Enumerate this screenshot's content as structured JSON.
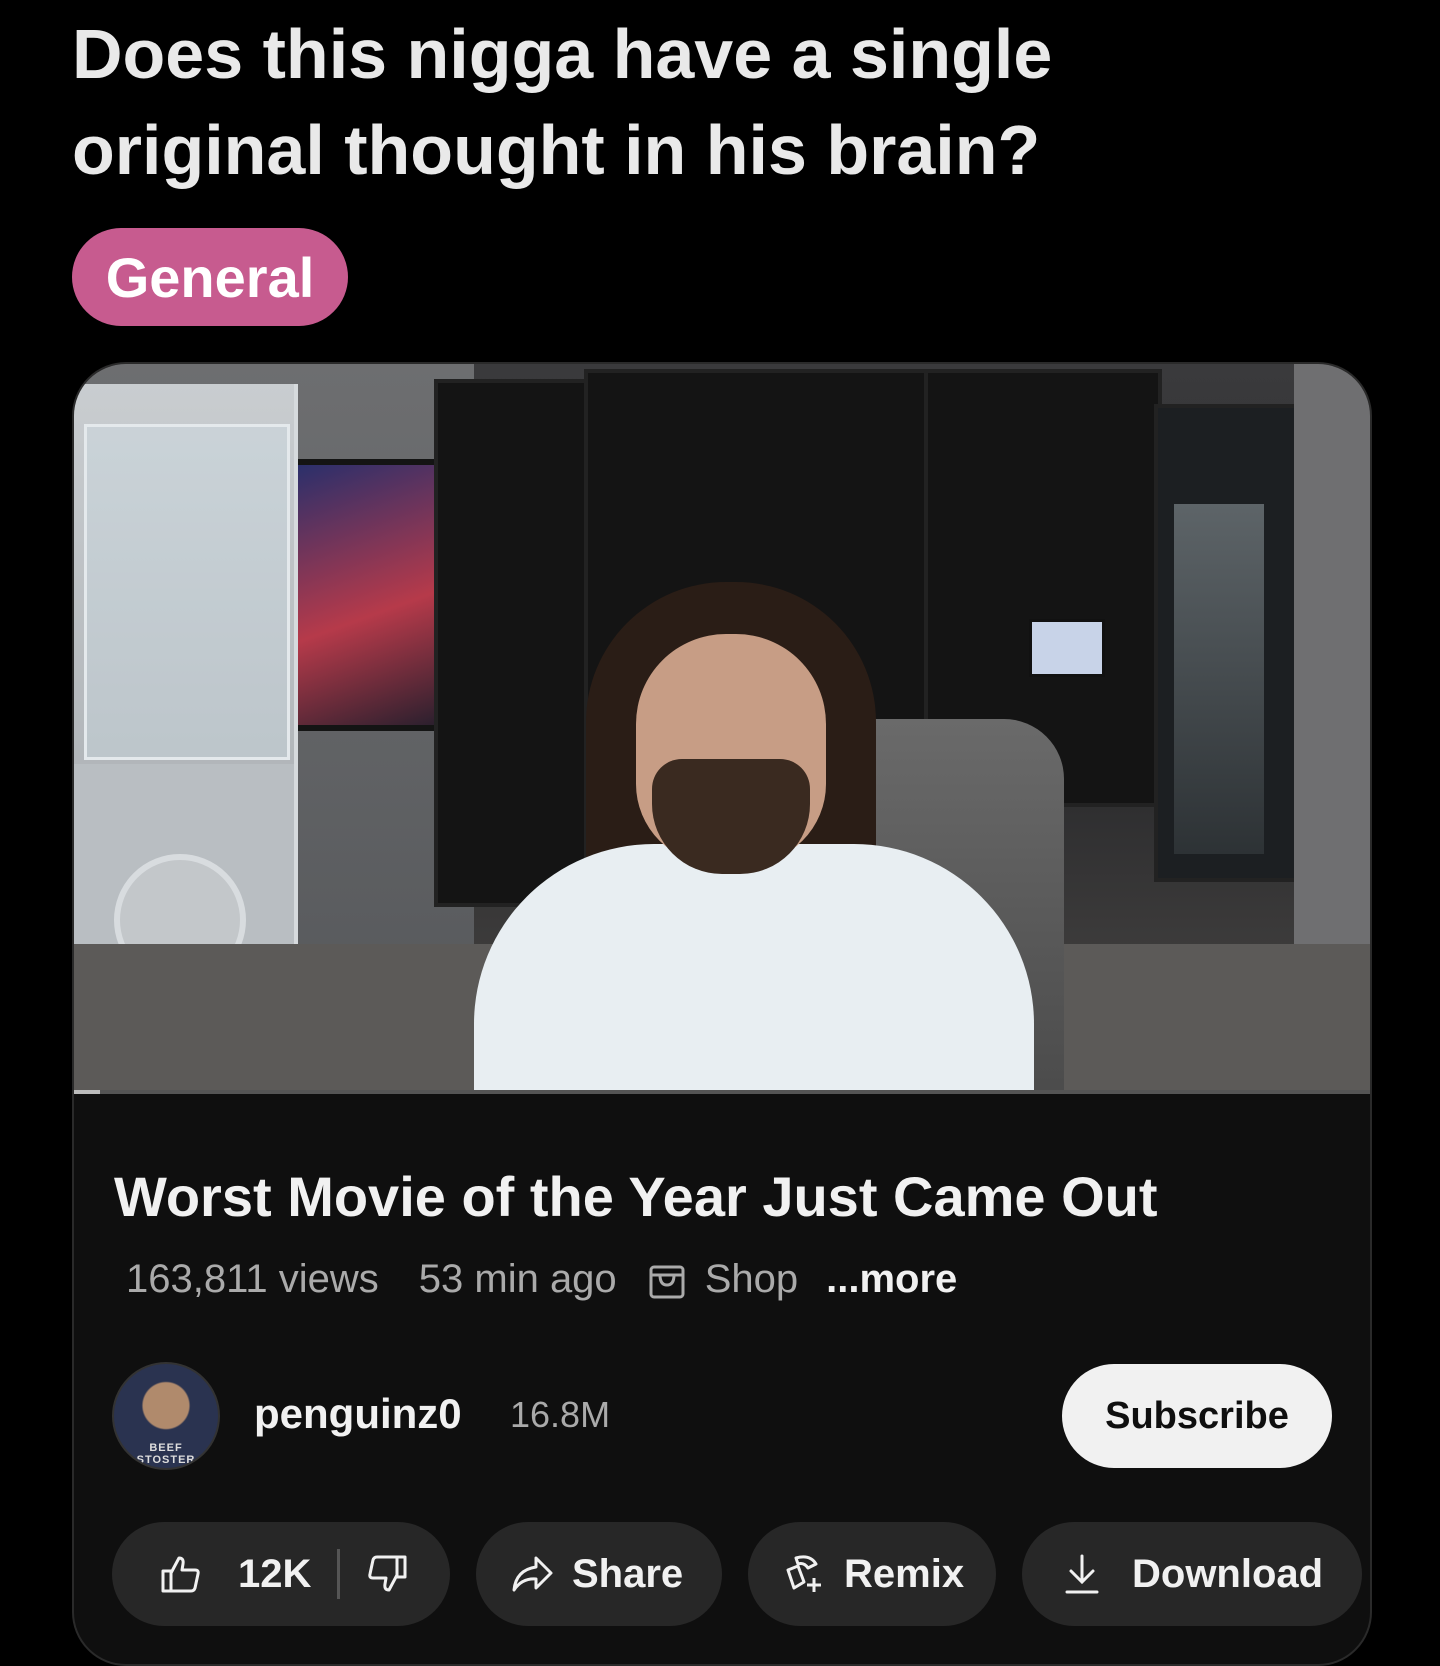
{
  "post": {
    "title": "Does this nigga have a single original thought in his brain?",
    "flair": "General",
    "flair_color": "#c75b8f"
  },
  "video": {
    "progress": 0.02,
    "title": "Worst Movie of the Year Just Came Out",
    "views": "163,811 views",
    "age": "53 min ago",
    "shop_label": "Shop",
    "more_label": "...more"
  },
  "channel": {
    "name": "penguinz0",
    "subscribers": "16.8M",
    "avatar_text": "BEEF STOSTER",
    "subscribe_label": "Subscribe"
  },
  "actions": {
    "likes": "12K",
    "share_label": "Share",
    "remix_label": "Remix",
    "download_label": "Download",
    "icons": [
      "thumbs-up-icon",
      "thumbs-down-icon",
      "share-arrow-icon",
      "remix-icon",
      "download-icon"
    ]
  }
}
